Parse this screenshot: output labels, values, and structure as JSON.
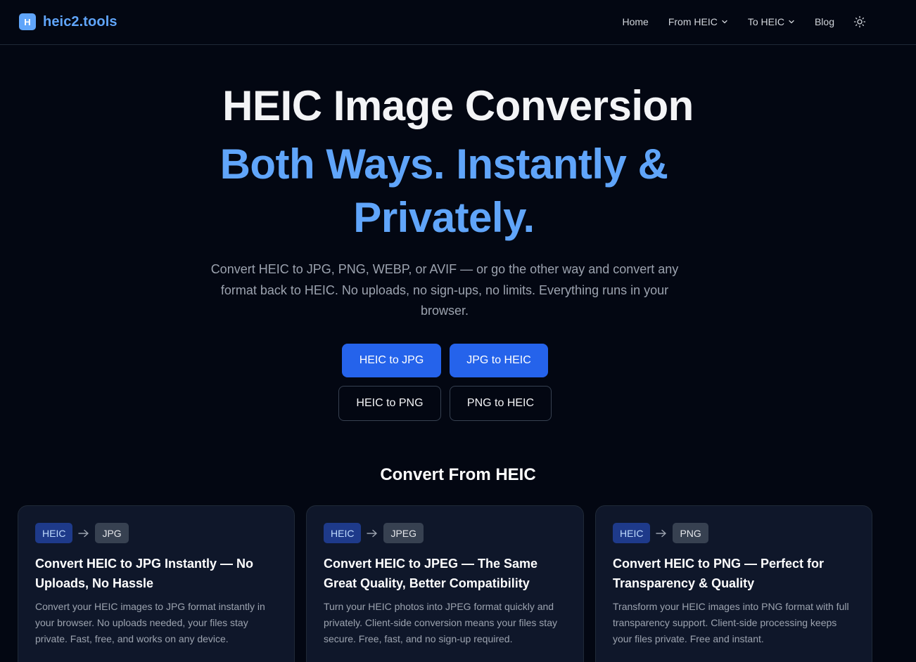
{
  "header": {
    "logo_letter": "H",
    "logo_text": "heic2.tools",
    "nav": {
      "home": "Home",
      "from_heic": "From HEIC",
      "to_heic": "To HEIC",
      "blog": "Blog"
    },
    "theme_icon": "sun-icon"
  },
  "hero": {
    "title": "HEIC Image Conversion",
    "subtitle": "Both Ways. Instantly & Privately.",
    "description": "Convert HEIC to JPG, PNG, WEBP, or AVIF — or go the other way and convert any format back to HEIC. No uploads, no sign-ups, no limits. Everything runs in your browser.",
    "buttons": {
      "heic_to_jpg": "HEIC to JPG",
      "jpg_to_heic": "JPG to HEIC",
      "heic_to_png": "HEIC to PNG",
      "png_to_heic": "PNG to HEIC"
    }
  },
  "section": {
    "title": "Convert From HEIC",
    "cards": [
      {
        "from": "HEIC",
        "to": "JPG",
        "title": "Convert HEIC to JPG Instantly — No Uploads, No Hassle",
        "description": "Convert your HEIC images to JPG format instantly in your browser. No uploads needed, your files stay private. Fast, free, and works on any device."
      },
      {
        "from": "HEIC",
        "to": "JPEG",
        "title": "Convert HEIC to JPEG — The Same Great Quality, Better Compatibility",
        "description": "Turn your HEIC photos into JPEG format quickly and privately. Client-side conversion means your files stay secure. Free, fast, and no sign-up required."
      },
      {
        "from": "HEIC",
        "to": "PNG",
        "title": "Convert HEIC to PNG — Perfect for Transparency & Quality",
        "description": "Transform your HEIC images into PNG format with full transparency support. Client-side processing keeps your files private. Free and instant."
      }
    ]
  },
  "colors": {
    "background": "#030712",
    "accent": "#60a5fa",
    "primary_button": "#2563eb",
    "card_bg": "#0f172a"
  }
}
